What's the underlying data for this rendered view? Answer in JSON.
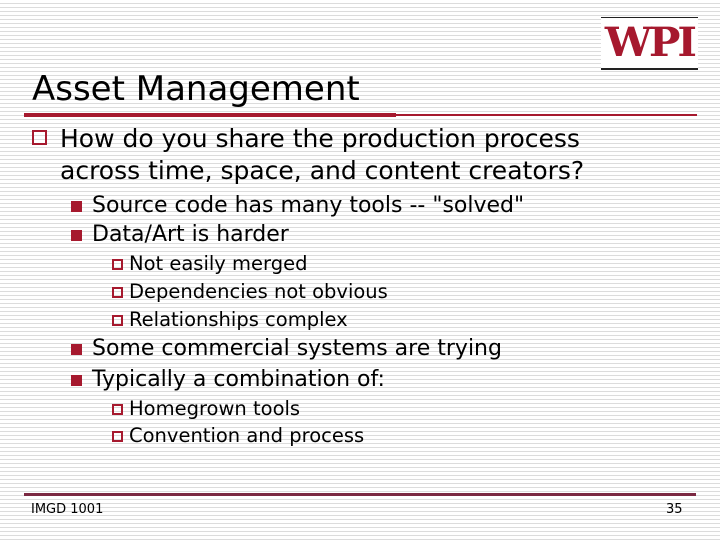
{
  "slide": {
    "logo_text": "WPI",
    "title": "Asset Management",
    "accent_color": "#a6192e",
    "bullets": [
      {
        "text_line1": "How do you share the production process",
        "text_line2": "across time, space, and content creators?",
        "children": [
          {
            "text": "Source code has many tools -- \"solved\""
          },
          {
            "text": "Data/Art is harder",
            "children": [
              {
                "text": "Not easily merged"
              },
              {
                "text": "Dependencies not obvious"
              },
              {
                "text": "Relationships complex"
              }
            ]
          },
          {
            "text": "Some commercial systems are trying"
          },
          {
            "text": "Typically a combination of:",
            "children": [
              {
                "text": "Homegrown tools"
              },
              {
                "text": "Convention and process"
              }
            ]
          }
        ]
      }
    ],
    "footer": {
      "course": "IMGD 1001",
      "page_number": "35"
    }
  }
}
